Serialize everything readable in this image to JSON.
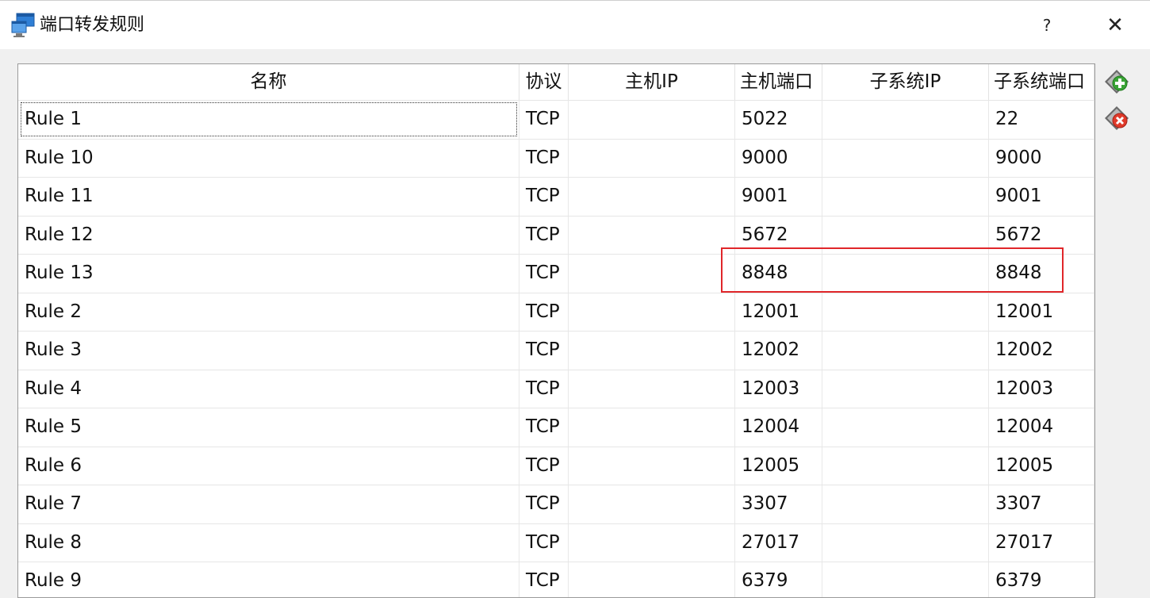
{
  "window": {
    "title": "端口转发规则",
    "help_label": "?",
    "close_label": "✕"
  },
  "colors": {
    "highlight_border": "#e0262a",
    "add_icon_green": "#3aa336",
    "remove_icon_red": "#e03a2a"
  },
  "table": {
    "columns": [
      "名称",
      "协议",
      "主机IP",
      "主机端口",
      "子系统IP",
      "子系统端口"
    ],
    "rows": [
      {
        "name": "Rule 1",
        "protocol": "TCP",
        "host_ip": "",
        "host_port": "5022",
        "guest_ip": "",
        "guest_port": "22"
      },
      {
        "name": "Rule 10",
        "protocol": "TCP",
        "host_ip": "",
        "host_port": "9000",
        "guest_ip": "",
        "guest_port": "9000"
      },
      {
        "name": "Rule 11",
        "protocol": "TCP",
        "host_ip": "",
        "host_port": "9001",
        "guest_ip": "",
        "guest_port": "9001"
      },
      {
        "name": "Rule 12",
        "protocol": "TCP",
        "host_ip": "",
        "host_port": "5672",
        "guest_ip": "",
        "guest_port": "5672"
      },
      {
        "name": "Rule 13",
        "protocol": "TCP",
        "host_ip": "",
        "host_port": "8848",
        "guest_ip": "",
        "guest_port": "8848"
      },
      {
        "name": "Rule 2",
        "protocol": "TCP",
        "host_ip": "",
        "host_port": "12001",
        "guest_ip": "",
        "guest_port": "12001"
      },
      {
        "name": "Rule 3",
        "protocol": "TCP",
        "host_ip": "",
        "host_port": "12002",
        "guest_ip": "",
        "guest_port": "12002"
      },
      {
        "name": "Rule 4",
        "protocol": "TCP",
        "host_ip": "",
        "host_port": "12003",
        "guest_ip": "",
        "guest_port": "12003"
      },
      {
        "name": "Rule 5",
        "protocol": "TCP",
        "host_ip": "",
        "host_port": "12004",
        "guest_ip": "",
        "guest_port": "12004"
      },
      {
        "name": "Rule 6",
        "protocol": "TCP",
        "host_ip": "",
        "host_port": "12005",
        "guest_ip": "",
        "guest_port": "12005"
      },
      {
        "name": "Rule 7",
        "protocol": "TCP",
        "host_ip": "",
        "host_port": "3307",
        "guest_ip": "",
        "guest_port": "3307"
      },
      {
        "name": "Rule 8",
        "protocol": "TCP",
        "host_ip": "",
        "host_port": "27017",
        "guest_ip": "",
        "guest_port": "27017"
      },
      {
        "name": "Rule 9",
        "protocol": "TCP",
        "host_ip": "",
        "host_port": "6379",
        "guest_ip": "",
        "guest_port": "6379"
      }
    ]
  },
  "side_buttons": {
    "add_icon": "add-rule-icon",
    "remove_icon": "remove-rule-icon"
  }
}
